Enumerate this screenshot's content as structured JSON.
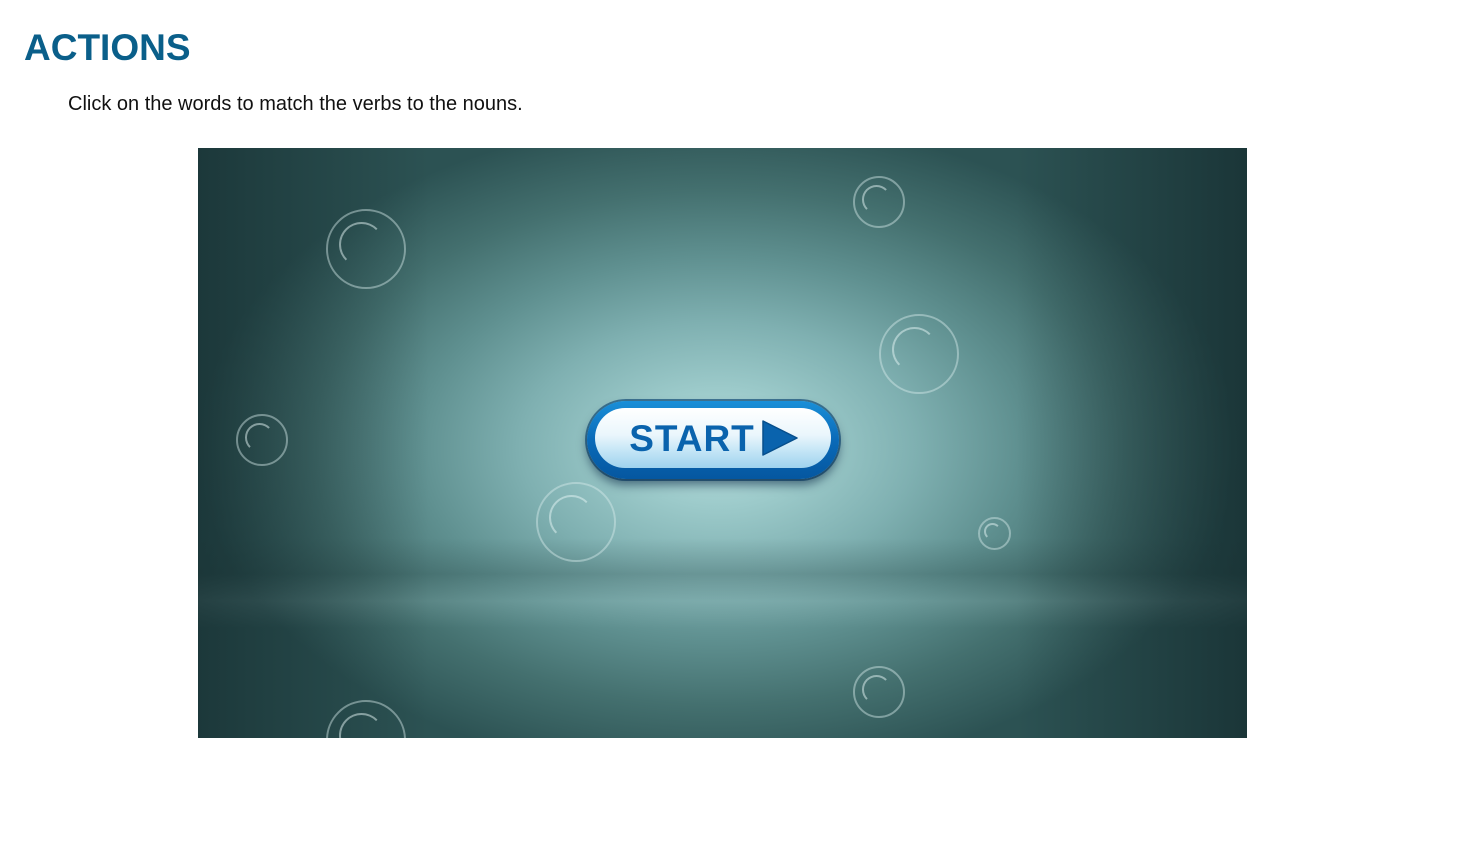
{
  "page": {
    "title": "ACTIONS",
    "instructions": "Click on the words to match the verbs to the nouns."
  },
  "game": {
    "start_button_label": "START",
    "start_icon": "play-arrow-icon",
    "colors": {
      "title": "#0a5f8a",
      "button_blue": "#0a63ad",
      "stage_center": "#b8dede",
      "stage_edge": "#2c5253"
    }
  }
}
